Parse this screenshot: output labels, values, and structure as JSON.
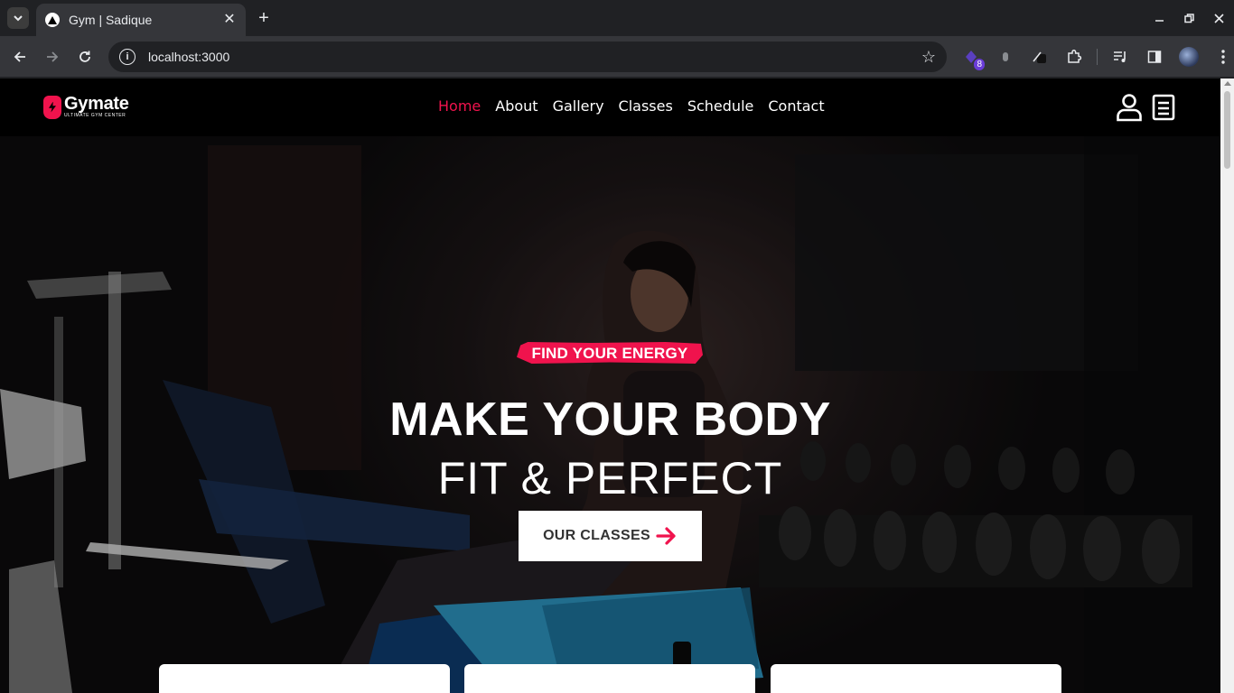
{
  "browser": {
    "tab_title": "Gym | Sadique",
    "url": "localhost:3000",
    "extension_badge": "8"
  },
  "site": {
    "brand": "Gymate",
    "tagline": "ULTIMATE GYM CENTER",
    "nav": [
      {
        "label": "Home",
        "active": true
      },
      {
        "label": "About",
        "active": false
      },
      {
        "label": "Gallery",
        "active": false
      },
      {
        "label": "Classes",
        "active": false
      },
      {
        "label": "Schedule",
        "active": false
      },
      {
        "label": "Contact",
        "active": false
      }
    ],
    "accent_color": "#f0134d"
  },
  "hero": {
    "badge": "FIND YOUR ENERGY",
    "title_line1": "MAKE YOUR BODY",
    "title_line2": "FIT & PERFECT",
    "cta_label": "OUR CLASSES"
  }
}
